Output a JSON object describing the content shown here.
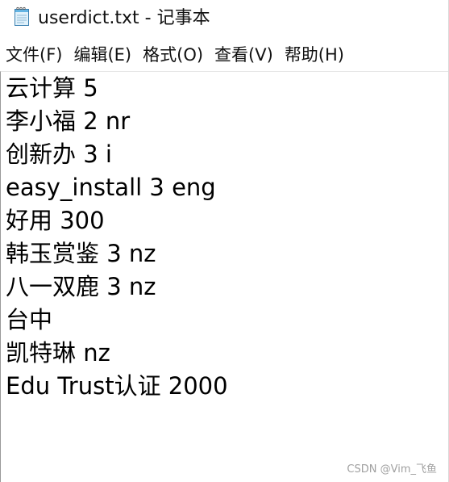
{
  "window": {
    "title": "userdict.txt - 记事本",
    "icon": "notepad-icon"
  },
  "menu": [
    {
      "label": "文件(F)"
    },
    {
      "label": "编辑(E)"
    },
    {
      "label": "格式(O)"
    },
    {
      "label": "查看(V)"
    },
    {
      "label": "帮助(H)"
    }
  ],
  "editor": {
    "lines": [
      "云计算 5",
      "李小福 2 nr",
      "创新办 3 i",
      "easy_install 3 eng",
      "好用 300",
      "韩玉赏鉴 3 nz",
      "八一双鹿 3 nz",
      "台中",
      "凯特琳 nz",
      "Edu Trust认证 2000"
    ]
  },
  "watermark": "CSDN @Vim_飞鱼"
}
